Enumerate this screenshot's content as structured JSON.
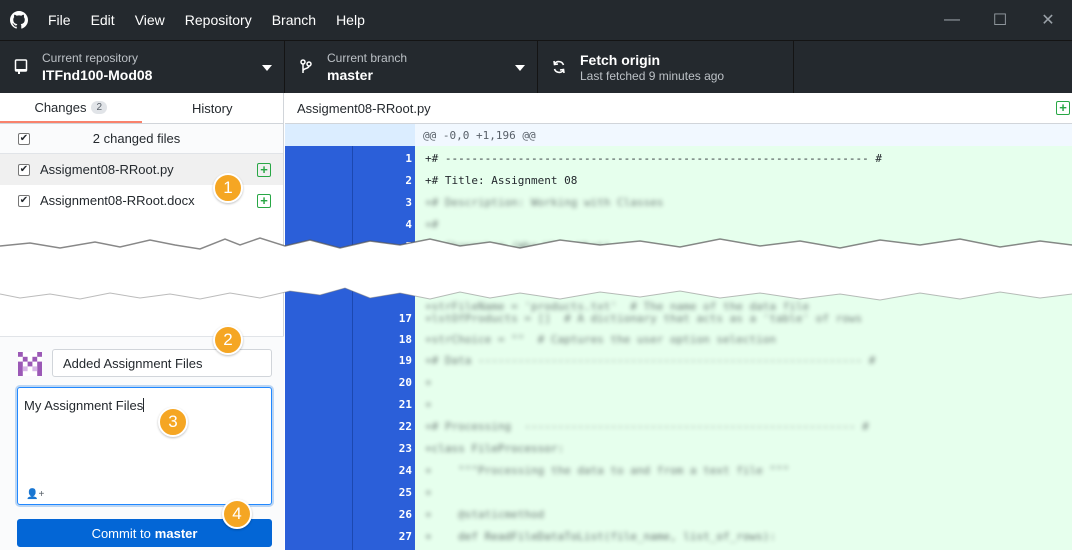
{
  "menubar": {
    "items": [
      "File",
      "Edit",
      "View",
      "Repository",
      "Branch",
      "Help"
    ]
  },
  "toolbar": {
    "repo_label": "Current repository",
    "repo_value": "ITFnd100-Mod08",
    "branch_label": "Current branch",
    "branch_value": "master",
    "fetch_label": "Fetch origin",
    "fetch_sub": "Last fetched 9 minutes ago"
  },
  "sidebar": {
    "tabs": [
      {
        "label": "Changes",
        "count": "2"
      },
      {
        "label": "History"
      }
    ],
    "changed_files_label": "2 changed files",
    "files": [
      {
        "name": "Assigment08-RRoot.py"
      },
      {
        "name": "Assignment08-RRoot.docx"
      }
    ]
  },
  "commit": {
    "summary": "Added Assignment Files",
    "description": "My Assignment Files",
    "button_prefix": "Commit to",
    "button_branch": "master"
  },
  "diff": {
    "file_name": "Assigment08-RRoot.py",
    "hunk_header": "@@ -0,0 +1,196 @@",
    "lines": [
      {
        "num": "1",
        "text": "+# ---------------------------------------------------------------- #"
      },
      {
        "num": "2",
        "text": "+# Title: Assignment 08"
      },
      {
        "num": "3",
        "text": ""
      },
      {
        "num": "4",
        "text": ""
      },
      {
        "num": "5",
        "text": ""
      },
      {
        "num": "17",
        "text": ""
      },
      {
        "num": "18",
        "text": ""
      },
      {
        "num": "19",
        "text": ""
      },
      {
        "num": "20",
        "text": ""
      },
      {
        "num": "21",
        "text": ""
      },
      {
        "num": "22",
        "text": ""
      },
      {
        "num": "23",
        "text": ""
      },
      {
        "num": "24",
        "text": ""
      },
      {
        "num": "25",
        "text": ""
      },
      {
        "num": "26",
        "text": ""
      },
      {
        "num": "27",
        "text": ""
      }
    ]
  },
  "callouts": [
    "1",
    "2",
    "3",
    "4"
  ],
  "colors": {
    "titlebar": "#24292e",
    "gutter": "#2b5fd9",
    "added_bg": "#e6ffed",
    "commit_button": "#0366d6",
    "callout": "#f5a623"
  }
}
